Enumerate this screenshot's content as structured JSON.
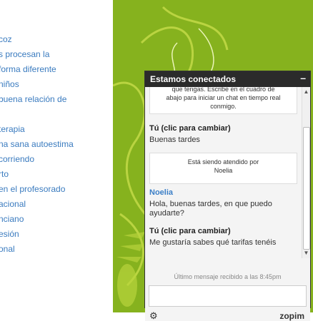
{
  "left_links": [
    "coz",
    "s procesan la",
    "forma diferente",
    "niños",
    " buena relación de",
    "terapia",
    "na sana autoestima",
    " corriendo",
    "rto",
    "en el profesorado",
    "acional",
    "nciano",
    "esión",
    "onal"
  ],
  "chat": {
    "header_title": "Estamos conectados",
    "minimize_label": "–",
    "intro_lines": [
      "que tengas. Escribe en el cuadro de",
      "abajo para iniciar un chat en tiempo real",
      "conmigo."
    ],
    "messages": [
      {
        "sender": "Tú (clic para cambiar)",
        "text": "Buenas tardes"
      },
      {
        "sender": "Noelia",
        "text": "Hola, buenas tardes, en que puedo ayudarte?"
      },
      {
        "sender": "Tú (clic para cambiar)",
        "text": "Me gustaría sabes qué tarifas tenéis"
      }
    ],
    "attended_lines": [
      "Está siendo atendido por",
      "Noelia"
    ],
    "status": "Último mensaje recibido a las 8:45pm",
    "input_value": "",
    "brand": "zopim",
    "scroll_up": "▲",
    "scroll_down": "▼",
    "gear_glyph": "⚙"
  },
  "colors": {
    "link": "#3a7bbf",
    "background_green": "#86b21e",
    "header": "#2b2b2b",
    "agent_name": "#3b7fc7"
  }
}
